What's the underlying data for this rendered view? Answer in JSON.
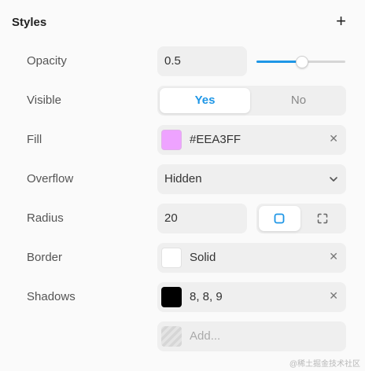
{
  "panel": {
    "title": "Styles",
    "add_icon": "plus-icon"
  },
  "opacity": {
    "label": "Opacity",
    "value": "0.5",
    "slider_fraction": 0.5,
    "accent": "#1e96e6"
  },
  "visible": {
    "label": "Visible",
    "options": [
      "Yes",
      "No"
    ],
    "selected": "Yes"
  },
  "fill": {
    "label": "Fill",
    "value": "#EEA3FF",
    "swatch_color": "#EEA3FF",
    "clear_icon": "close-icon"
  },
  "overflow": {
    "label": "Overflow",
    "value": "Hidden",
    "icon": "chevron-down-icon"
  },
  "radius": {
    "label": "Radius",
    "value": "20",
    "modes": [
      "uniform-corners-icon",
      "individual-corners-icon"
    ],
    "selected_mode": "uniform-corners-icon"
  },
  "border": {
    "label": "Border",
    "value": "Solid",
    "swatch_color": "#FFFFFF",
    "clear_icon": "close-icon"
  },
  "shadows": {
    "label": "Shadows",
    "value": "8, 8, 9",
    "swatch_color": "#000000",
    "clear_icon": "close-icon"
  },
  "add": {
    "placeholder": "Add..."
  },
  "watermark": "@稀土掘金技术社区"
}
